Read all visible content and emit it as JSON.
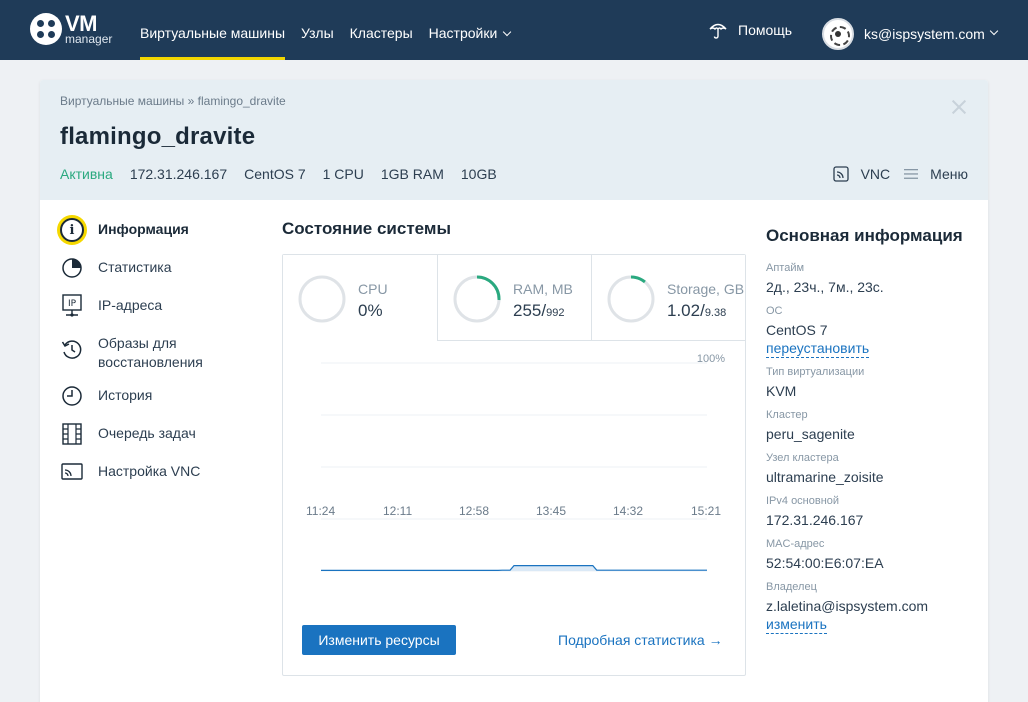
{
  "brand": {
    "logo_main": "VM",
    "logo_sub": "manager"
  },
  "nav": [
    {
      "label": "Виртуальные машины"
    },
    {
      "label": "Узлы"
    },
    {
      "label": "Кластеры"
    },
    {
      "label": "Настройки"
    }
  ],
  "help_label": "Помощь",
  "user_label": "ks@ispsystem.com",
  "breadcrumb": "Виртуальные машины » flamingo_dravite",
  "vm": {
    "name": "flamingo_dravite",
    "status": "Активна",
    "ip": "172.31.246.167",
    "os": "CentOS 7",
    "cpu": "1 CPU",
    "ram": "1GB RAM",
    "disk": "10GB"
  },
  "actions": {
    "vnc": "VNC",
    "menu": "Меню"
  },
  "side_menu": [
    {
      "label": "Информация",
      "icon": "info-icon"
    },
    {
      "label": "Статистика",
      "icon": "pie-chart-icon"
    },
    {
      "label": "IP-адреса",
      "icon": "ip-icon"
    },
    {
      "label": "Образы для восстановления",
      "icon": "restore-icon"
    },
    {
      "label": "История",
      "icon": "clock-icon"
    },
    {
      "label": "Очередь задач",
      "icon": "queue-icon"
    },
    {
      "label": "Настройка VNC",
      "icon": "vnc-icon"
    }
  ],
  "system_state": {
    "title": "Состояние системы",
    "meters": [
      {
        "label": "CPU",
        "value": "0%",
        "total": "",
        "fraction": 0
      },
      {
        "label": "RAM, MB",
        "value": "255/",
        "total": "992",
        "fraction": 0.257
      },
      {
        "label": "Storage, GB",
        "value": "1.02/",
        "total": "9.38",
        "fraction": 0.109
      }
    ],
    "accent": "#2aa97f"
  },
  "chart_data": {
    "type": "area",
    "x": [
      "11:24",
      "12:11",
      "12:58",
      "13:45",
      "14:32",
      "15:21"
    ],
    "ylim": [
      0,
      100
    ],
    "ymax_label": "100%",
    "series": [
      {
        "values": [
          0.3,
          0.3,
          0.3,
          0.3,
          0.3,
          0.3,
          0.3,
          0.3,
          0.3,
          0.3,
          0.3,
          0.3,
          0.3,
          0.3,
          0.3,
          0.3,
          0.3,
          0.3,
          0.3,
          0.3,
          0.3,
          0.3,
          0.3,
          0.3,
          0.3,
          0.3,
          0.3,
          0.3,
          0.3,
          0.3,
          0.3,
          0.3,
          0.3,
          0.3,
          0.3,
          0.3,
          0.3,
          0.3,
          0.3,
          0.3,
          0.3,
          0.3,
          0.3,
          0.3,
          0.3,
          0.3,
          0.4,
          0.4,
          0.4,
          2.6,
          2.6,
          2.6,
          2.6,
          2.6,
          2.6,
          2.6,
          2.6,
          2.6,
          2.6,
          2.6,
          2.6,
          2.6,
          2.6,
          2.6,
          2.6,
          2.6,
          2.6,
          2.6,
          2.6,
          2.6,
          0.4,
          0.4,
          0.4,
          0.4,
          0.4,
          0.4,
          0.4,
          0.4,
          0.4,
          0.4,
          0.4,
          0.4,
          0.4,
          0.4,
          0.4,
          0.4,
          0.4,
          0.4,
          0.4,
          0.4,
          0.4,
          0.4,
          0.4,
          0.4,
          0.4,
          0.4,
          0.4,
          0.4,
          0.4
        ]
      }
    ],
    "grid": true,
    "line_color": "#1a73c0"
  },
  "buttons": {
    "resize": "Изменить ресурсы",
    "details": "Подробная статистика →"
  },
  "main_info": {
    "title": "Основная информация",
    "uptime_label": "Аптайм",
    "uptime": "2д., 23ч., 7м., 23с.",
    "os_label": "ОС",
    "os": "CentOS 7",
    "reinstall": "переустановить",
    "virt_label": "Тип виртуализации",
    "virt": "KVM",
    "cluster_label": "Кластер",
    "cluster": "peru_sagenite",
    "node_label": "Узел кластера",
    "node": "ultramarine_zoisite",
    "ipv4_label": "IPv4 основной",
    "ipv4": "172.31.246.167",
    "mac_label": "MAC-адрес",
    "mac": "52:54:00:E6:07:EA",
    "owner_label": "Владелец",
    "owner": "z.laletina@ispsystem.com",
    "change": "изменить"
  }
}
